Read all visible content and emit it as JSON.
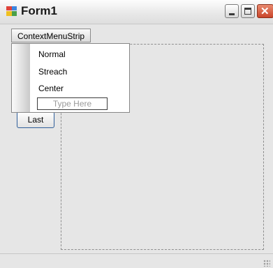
{
  "window": {
    "title": "Form1"
  },
  "menustrip": {
    "context_label": "ContextMenuStrip"
  },
  "dropdown": {
    "items": [
      "Normal",
      "Streach",
      "Center"
    ],
    "type_here_placeholder": "Type Here"
  },
  "button": {
    "last_label": "Last"
  },
  "colors": {
    "close_button": "#c9452a",
    "button_border": "#2f5e9a"
  }
}
